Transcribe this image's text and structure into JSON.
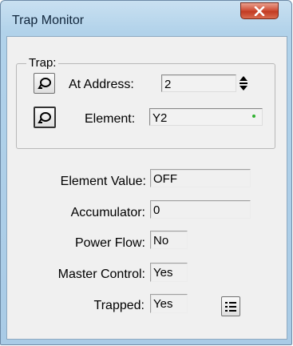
{
  "window": {
    "title": "Trap Monitor",
    "close_symbol": "X"
  },
  "trap": {
    "group_label": "Trap:",
    "address_label": "At Address:",
    "address_value": "2",
    "element_label": "Element:",
    "element_value": "Y2",
    "element_status_color": "#2fb12f"
  },
  "info": {
    "element_value_label": "Element Value:",
    "element_value": "OFF",
    "accumulator_label": "Accumulator:",
    "accumulator_value": "0",
    "power_flow_label": "Power Flow:",
    "power_flow_value": "No",
    "master_control_label": "Master Control:",
    "master_control_value": "Yes",
    "trapped_label": "Trapped:",
    "trapped_value": "Yes"
  },
  "icons": {
    "address_button": "lock-icon",
    "element_button": "lock-icon",
    "spinner": "up-down-spinner-icon",
    "list_button": "list-icon"
  },
  "colors": {
    "title_bar": "#aed0ea",
    "close_button": "#c9452c",
    "client_bg": "#f0f0f0"
  }
}
